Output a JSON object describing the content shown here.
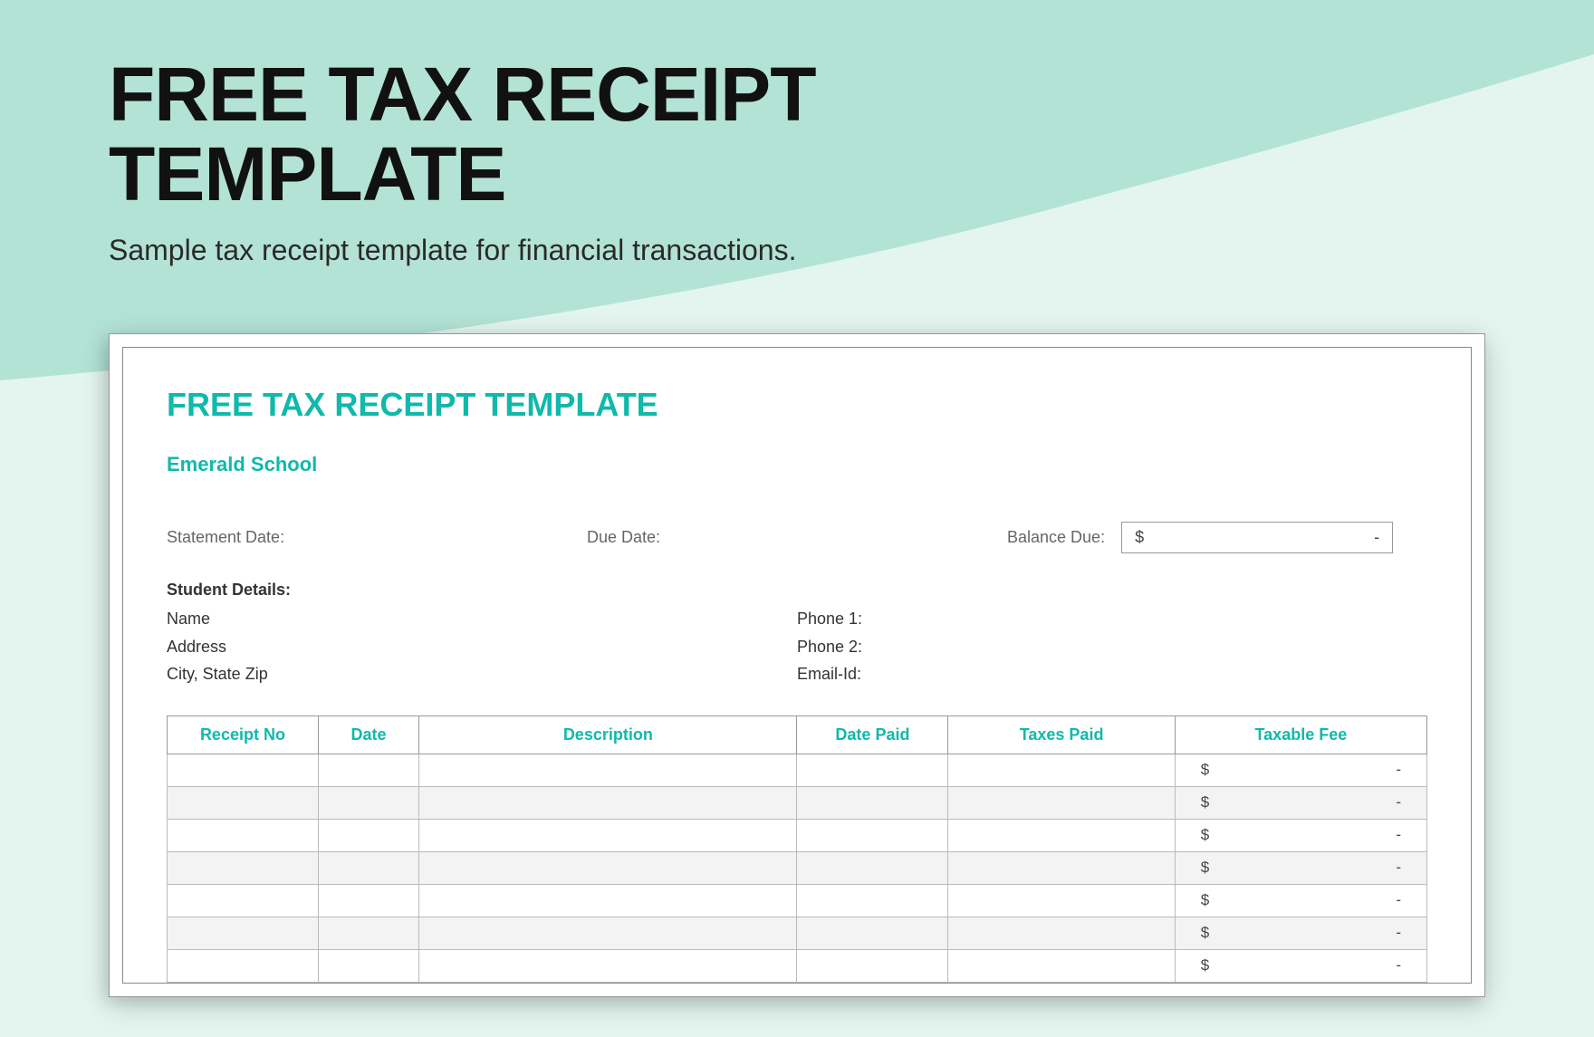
{
  "header": {
    "title_line1": "FREE TAX RECEIPT",
    "title_line2": "TEMPLATE",
    "subtitle": "Sample tax receipt template for financial transactions."
  },
  "document": {
    "title": "FREE TAX RECEIPT TEMPLATE",
    "school_name": "Emerald School",
    "labels": {
      "statement_date": "Statement Date:",
      "due_date": "Due Date:",
      "balance_due": "Balance Due:",
      "student_details": "Student Details:",
      "name": "Name",
      "address": "Address",
      "city_state_zip": "City, State Zip",
      "phone1": "Phone 1:",
      "phone2": "Phone 2:",
      "email": "Email-Id:"
    },
    "balance_box": {
      "currency": "$",
      "value": "-"
    },
    "table": {
      "headers": {
        "receipt_no": "Receipt No",
        "date": "Date",
        "description": "Description",
        "date_paid": "Date Paid",
        "taxes_paid": "Taxes Paid",
        "taxable_fee": "Taxable Fee"
      },
      "rows": [
        {
          "currency": "$",
          "value": "-"
        },
        {
          "currency": "$",
          "value": "-"
        },
        {
          "currency": "$",
          "value": "-"
        },
        {
          "currency": "$",
          "value": "-"
        },
        {
          "currency": "$",
          "value": "-"
        },
        {
          "currency": "$",
          "value": "-"
        },
        {
          "currency": "$",
          "value": "-"
        }
      ]
    }
  }
}
